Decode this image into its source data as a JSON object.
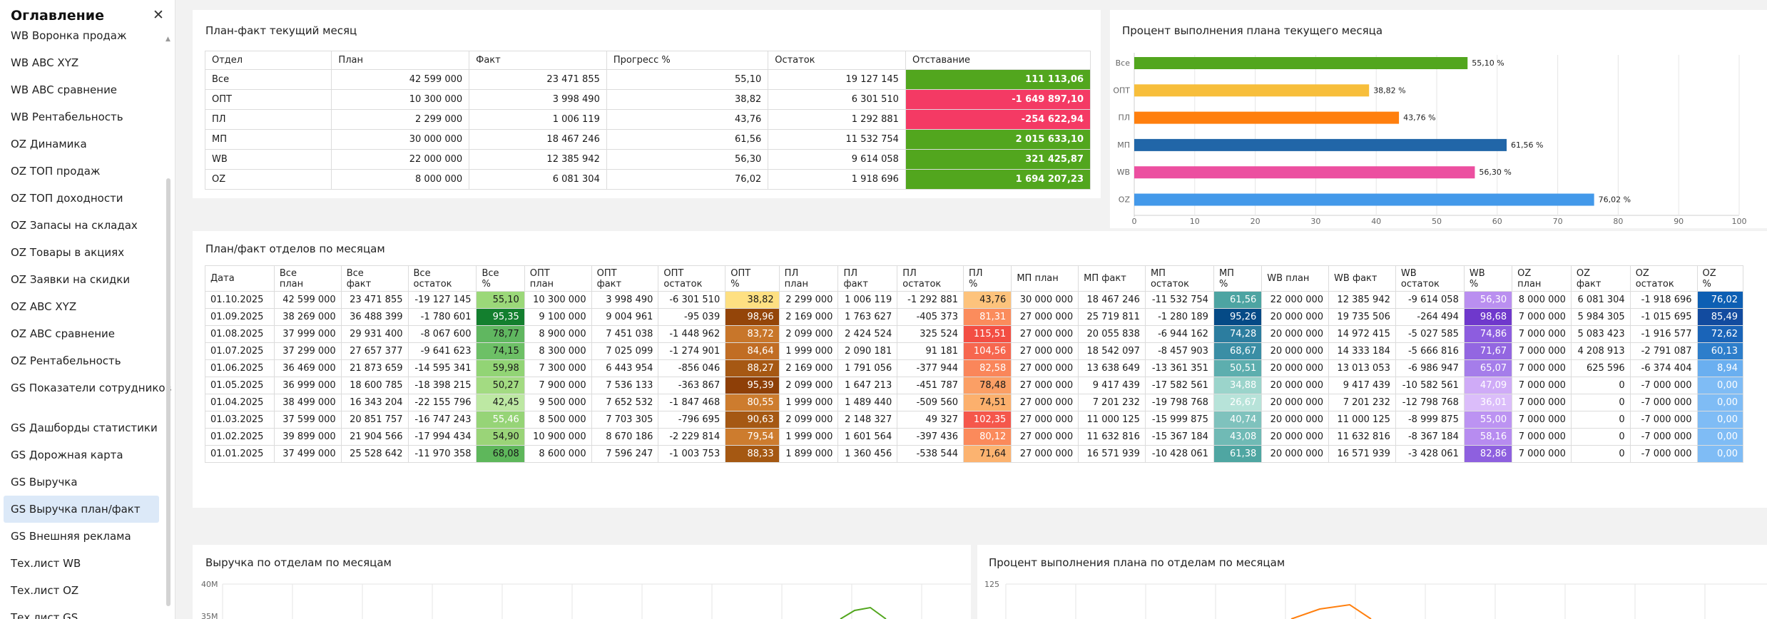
{
  "sidebar": {
    "title": "Оглавление",
    "items": [
      {
        "label": "WB Воронка продаж"
      },
      {
        "label": "WB ABC XYZ"
      },
      {
        "label": "WB ABC сравнение"
      },
      {
        "label": "WB Рентабельность"
      },
      {
        "label": "OZ Динамика"
      },
      {
        "label": "OZ ТОП продаж"
      },
      {
        "label": "OZ ТОП доходности"
      },
      {
        "label": "OZ Запасы на складах"
      },
      {
        "label": "OZ Товары в акциях"
      },
      {
        "label": "OZ Заявки на скидки"
      },
      {
        "label": "OZ ABC XYZ"
      },
      {
        "label": "OZ ABC сравнение"
      },
      {
        "label": "OZ Рентабельность"
      },
      {
        "label": "GS Показатели сотрудников"
      },
      {
        "label": "GS Дашборды статистики"
      },
      {
        "label": "GS Дорожная карта"
      },
      {
        "label": "GS Выручка"
      },
      {
        "label": "GS Выручка план/факт"
      },
      {
        "label": "GS Внешняя реклама"
      },
      {
        "label": "Тех.лист WB"
      },
      {
        "label": "Тех.лист OZ"
      },
      {
        "label": "Тех.лист GS"
      }
    ]
  },
  "plan_fact": {
    "title": "План-факт текущий месяц",
    "headers": [
      "Отдел",
      "План",
      "Факт",
      "Прогресс %",
      "Остаток",
      "Отставание"
    ],
    "rows": [
      [
        "Все",
        "42 599 000",
        "23 471 855",
        "55,10",
        "19 127 145",
        "111 113,06"
      ],
      [
        "ОПТ",
        "10 300 000",
        "3 998 490",
        "38,82",
        "6 301 510",
        "-1 649 897,10"
      ],
      [
        "ПЛ",
        "2 299 000",
        "1 006 119",
        "43,76",
        "1 292 881",
        "-254 622,94"
      ],
      [
        "МП",
        "30 000 000",
        "18 467 246",
        "61,56",
        "11 532 754",
        "2 015 633,10"
      ],
      [
        "WB",
        "22 000 000",
        "12 385 942",
        "56,30",
        "9 614 058",
        "321 425,87"
      ],
      [
        "OZ",
        "8 000 000",
        "6 081 304",
        "76,02",
        "1 918 696",
        "1 694 207,23"
      ]
    ],
    "lag_colors": [
      "#52a61e",
      "#f43a64",
      "#f43a64",
      "#52a61e",
      "#52a61e",
      "#52a61e"
    ]
  },
  "pct_chart": {
    "title": "Процент выполнения плана текущего месяца",
    "chart_data": {
      "type": "bar",
      "orientation": "horizontal",
      "categories": [
        "Все",
        "ОПТ",
        "ПЛ",
        "МП",
        "WB",
        "OZ"
      ],
      "values": [
        55.1,
        38.82,
        43.76,
        61.56,
        56.3,
        76.02
      ],
      "labels": [
        "55,10 %",
        "38,82 %",
        "43,76 %",
        "61,56 %",
        "56,30 %",
        "76,02 %"
      ],
      "colors": [
        "#52a61e",
        "#f7be3b",
        "#ff7f0e",
        "#2166a8",
        "#ec4fa0",
        "#4399ea"
      ],
      "xlim": [
        0,
        100
      ],
      "xticks": [
        "0",
        "10",
        "20",
        "30",
        "40",
        "50",
        "60",
        "70",
        "80",
        "90",
        "100"
      ]
    }
  },
  "monthly": {
    "title": "План/факт отделов по месяцам",
    "headers": [
      "Дата",
      "Все\nплан",
      "Все\nфакт",
      "Все\nостаток",
      "Все\n%",
      "ОПТ\nплан",
      "ОПТ\nфакт",
      "ОПТ\nостаток",
      "ОПТ\n%",
      "ПЛ\nплан",
      "ПЛ\nфакт",
      "ПЛ\nостаток",
      "ПЛ\n%",
      "МП план",
      "МП факт",
      "МП\nостаток",
      "МП\n%",
      "WB план",
      "WB факт",
      "WB\nостаток",
      "WB\n%",
      "OZ\nплан",
      "OZ\nфакт",
      "OZ\nостаток",
      "OZ\n%"
    ],
    "rows": [
      [
        "01.10.2025",
        "42 599 000",
        "23 471 855",
        "-19 127 145",
        "55,10",
        "10 300 000",
        "3 998 490",
        "-6 301 510",
        "38,82",
        "2 299 000",
        "1 006 119",
        "-1 292 881",
        "43,76",
        "30 000 000",
        "18 467 246",
        "-11 532 754",
        "61,56",
        "22 000 000",
        "12 385 942",
        "-9 614 058",
        "56,30",
        "8 000 000",
        "6 081 304",
        "-1 918 696",
        "76,02"
      ],
      [
        "01.09.2025",
        "38 269 000",
        "36 488 399",
        "-1 780 601",
        "95,35",
        "9 100 000",
        "9 004 961",
        "-95 039",
        "98,96",
        "2 169 000",
        "1 763 627",
        "-405 373",
        "81,31",
        "27 000 000",
        "25 719 811",
        "-1 280 189",
        "95,26",
        "20 000 000",
        "19 735 506",
        "-264 494",
        "98,68",
        "7 000 000",
        "5 984 305",
        "-1 015 695",
        "85,49"
      ],
      [
        "01.08.2025",
        "37 999 000",
        "29 931 400",
        "-8 067 600",
        "78,77",
        "8 900 000",
        "7 451 038",
        "-1 448 962",
        "83,72",
        "2 099 000",
        "2 424 524",
        "325 524",
        "115,51",
        "27 000 000",
        "20 055 838",
        "-6 944 162",
        "74,28",
        "20 000 000",
        "14 972 415",
        "-5 027 585",
        "74,86",
        "7 000 000",
        "5 083 423",
        "-1 916 577",
        "72,62"
      ],
      [
        "01.07.2025",
        "37 299 000",
        "27 657 377",
        "-9 641 623",
        "74,15",
        "8 300 000",
        "7 025 099",
        "-1 274 901",
        "84,64",
        "1 999 000",
        "2 090 181",
        "91 181",
        "104,56",
        "27 000 000",
        "18 542 097",
        "-8 457 903",
        "68,67",
        "20 000 000",
        "14 333 184",
        "-5 666 816",
        "71,67",
        "7 000 000",
        "4 208 913",
        "-2 791 087",
        "60,13"
      ],
      [
        "01.06.2025",
        "36 469 000",
        "21 873 659",
        "-14 595 341",
        "59,98",
        "7 300 000",
        "6 443 954",
        "-856 046",
        "88,27",
        "2 169 000",
        "1 791 056",
        "-377 944",
        "82,58",
        "27 000 000",
        "13 638 649",
        "-13 361 351",
        "50,51",
        "20 000 000",
        "13 013 053",
        "-6 986 947",
        "65,07",
        "7 000 000",
        "625 596",
        "-6 374 404",
        "8,94"
      ],
      [
        "01.05.2025",
        "36 999 000",
        "18 600 785",
        "-18 398 215",
        "50,27",
        "7 900 000",
        "7 536 133",
        "-363 867",
        "95,39",
        "2 099 000",
        "1 647 213",
        "-451 787",
        "78,48",
        "27 000 000",
        "9 417 439",
        "-17 582 561",
        "34,88",
        "20 000 000",
        "9 417 439",
        "-10 582 561",
        "47,09",
        "7 000 000",
        "0",
        "-7 000 000",
        "0,00"
      ],
      [
        "01.04.2025",
        "38 499 000",
        "16 343 204",
        "-22 155 796",
        "42,45",
        "9 500 000",
        "7 652 532",
        "-1 847 468",
        "80,55",
        "1 999 000",
        "1 489 440",
        "-509 560",
        "74,51",
        "27 000 000",
        "7 201 232",
        "-19 798 768",
        "26,67",
        "20 000 000",
        "7 201 232",
        "-12 798 768",
        "36,01",
        "7 000 000",
        "0",
        "-7 000 000",
        "0,00"
      ],
      [
        "01.03.2025",
        "37 599 000",
        "20 851 757",
        "-16 747 243",
        "55,46",
        "8 500 000",
        "7 703 305",
        "-796 695",
        "90,63",
        "2 099 000",
        "2 148 327",
        "49 327",
        "102,35",
        "27 000 000",
        "11 000 125",
        "-15 999 875",
        "40,74",
        "20 000 000",
        "11 000 125",
        "-8 999 875",
        "55,00",
        "7 000 000",
        "0",
        "-7 000 000",
        "0,00"
      ],
      [
        "01.02.2025",
        "39 899 000",
        "21 904 566",
        "-17 994 434",
        "54,90",
        "10 900 000",
        "8 670 186",
        "-2 229 814",
        "79,54",
        "1 999 000",
        "1 601 564",
        "-397 436",
        "80,12",
        "27 000 000",
        "11 632 816",
        "-15 367 184",
        "43,08",
        "20 000 000",
        "11 632 816",
        "-8 367 184",
        "58,16",
        "7 000 000",
        "0",
        "-7 000 000",
        "0,00"
      ],
      [
        "01.01.2025",
        "37 499 000",
        "25 528 642",
        "-11 970 358",
        "68,08",
        "8 600 000",
        "7 596 247",
        "-1 003 753",
        "88,33",
        "1 899 000",
        "1 360 456",
        "-538 544",
        "71,64",
        "27 000 000",
        "16 571 939",
        "-10 428 061",
        "61,38",
        "20 000 000",
        "16 571 939",
        "-3 428 061",
        "82,86",
        "7 000 000",
        "0",
        "-7 000 000",
        "0,00"
      ]
    ],
    "cell_colors": {
      "4": [
        "#9bd879",
        "#137f2e",
        "#60b760",
        "#6dc066",
        "#92d475",
        "#a3db82",
        "#bde8a3",
        "#96d477",
        "#9ad478",
        "#5eb75b"
      ],
      "8": [
        "#fee082",
        "#944509",
        "#c8762a",
        "#c16d24",
        "#a65813",
        "#8e3f07",
        "#cd7c2e",
        "#a55813",
        "#cd7c2e",
        "#a55812"
      ],
      "12": [
        "#fdc37c",
        "#fb8c5c",
        "#f34e43",
        "#f7674f",
        "#fa865a",
        "#fb9f65",
        "#fcb06d",
        "#f5574b",
        "#fb8a5b",
        "#fcb370"
      ],
      "16": [
        "#4da4a2",
        "#054a86",
        "#2c7d9f",
        "#3a8ea5",
        "#5daeae",
        "#9bd4cb",
        "#b7e3d9",
        "#7fc2bd",
        "#70bab5",
        "#4fa6a2"
      ],
      "20": [
        "#ba8ff0",
        "#6f38cc",
        "#8d5ddf",
        "#9366e1",
        "#a57dea",
        "#cfabf7",
        "#dbbdfa",
        "#bc93f2",
        "#b78cf0",
        "#8e60df"
      ],
      "24": [
        "#0d5fb3",
        "#124b9f",
        "#1a64b8",
        "#2d7ecb",
        "#6aaff0",
        "#7fbcf5",
        "#7fbcf5",
        "#7fbcf5",
        "#7fbcf5",
        "#7fbcf5"
      ]
    },
    "white_cells": {
      "4": [
        1,
        7
      ],
      "8": [
        1,
        2,
        3,
        4,
        5,
        6,
        7,
        8,
        9
      ],
      "12": [
        1,
        2,
        3,
        4,
        7,
        8
      ],
      "16": [
        0,
        1,
        2,
        3,
        4,
        5,
        6,
        7,
        8,
        9
      ],
      "20": [
        0,
        1,
        2,
        3,
        4,
        5,
        6,
        7,
        8,
        9
      ],
      "24": [
        0,
        1,
        2,
        3,
        4,
        5,
        6,
        7,
        8,
        9
      ]
    }
  },
  "revenue_chart": {
    "title": "Выручка по отделам по месяцам",
    "yticks": [
      "40M",
      "35M"
    ],
    "line_color": "#52a61e"
  },
  "percent_chart": {
    "title": "Процент выполнения плана по отделам по месяцам",
    "yticks": [
      "125"
    ],
    "line_color": "#ff7f0e"
  }
}
